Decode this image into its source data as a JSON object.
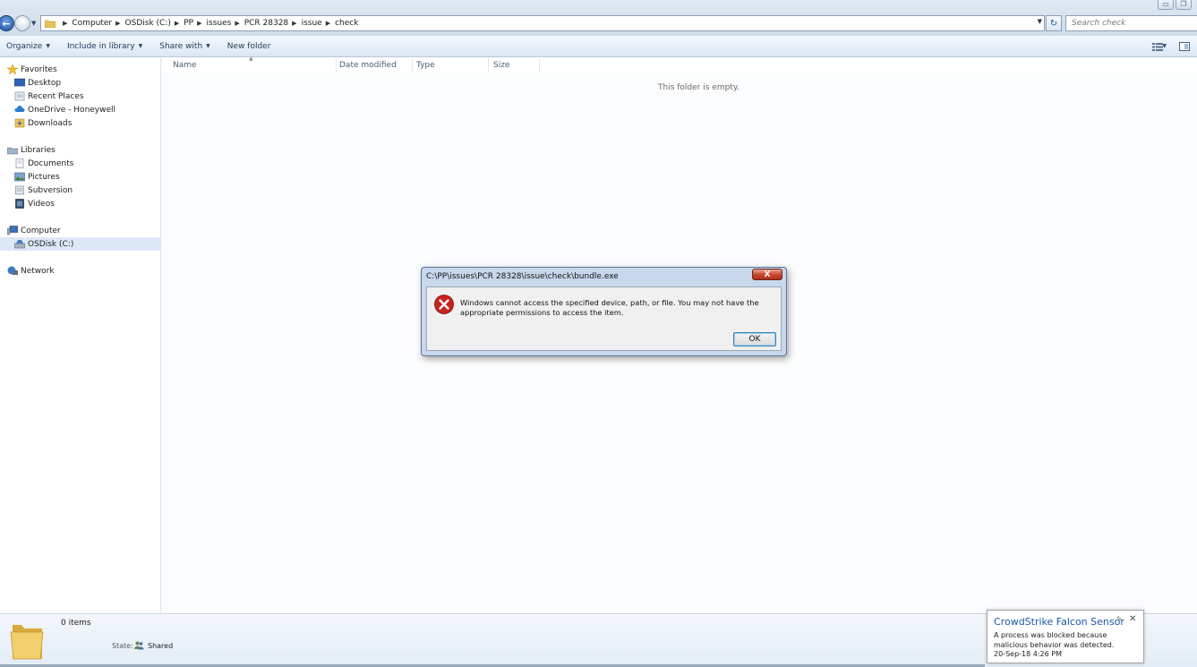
{
  "window": {
    "minimize_glyph": "▭",
    "maximize_glyph": "❐"
  },
  "address_bar": {
    "breadcrumbs": [
      "Computer",
      "OSDisk (C:)",
      "PP",
      "issues",
      "PCR 28328",
      "issue",
      "check"
    ]
  },
  "search": {
    "placeholder": "Search check"
  },
  "toolbar": {
    "organize_label": "Organize",
    "include_label": "Include in library",
    "share_label": "Share with",
    "new_folder_label": "New folder"
  },
  "sidebar": {
    "favorites": "Favorites",
    "desktop": "Desktop",
    "recent": "Recent Places",
    "onedrive": "OneDrive - Honeywell",
    "downloads": "Downloads",
    "libraries": "Libraries",
    "documents": "Documents",
    "pictures": "Pictures",
    "subversion": "Subversion",
    "videos": "Videos",
    "computer": "Computer",
    "osdisk": "OSDisk (C:)",
    "network": "Network"
  },
  "columns": {
    "name": "Name",
    "date_modified": "Date modified",
    "type": "Type",
    "size": "Size"
  },
  "main": {
    "empty_text": "This folder is empty."
  },
  "details": {
    "items_count": "0 items",
    "state_label": "State:",
    "state_value": "Shared"
  },
  "dialog": {
    "title": "C:\\PP\\issues\\PCR 28328\\issue\\check\\bundle.exe",
    "message": "Windows cannot access the specified device, path, or file.  You may not have the appropriate permissions to access the item.",
    "ok_label": "OK",
    "close_glyph": "X"
  },
  "toast": {
    "title": "CrowdStrike Falcon Sensor",
    "message": "A process was blocked because malicious behavior was detected.",
    "timestamp": "20-Sep-18 4:26 PM",
    "close_glyph": "✕",
    "pin_glyph": "✎"
  },
  "colors": {
    "accent": "#1b56a5",
    "error": "#c8452d",
    "selection": "#dce8f6"
  },
  "icons": {
    "back": "back-arrow-icon",
    "forward": "forward-arrow-icon",
    "refresh": "refresh-icon",
    "error": "error-x-icon"
  }
}
